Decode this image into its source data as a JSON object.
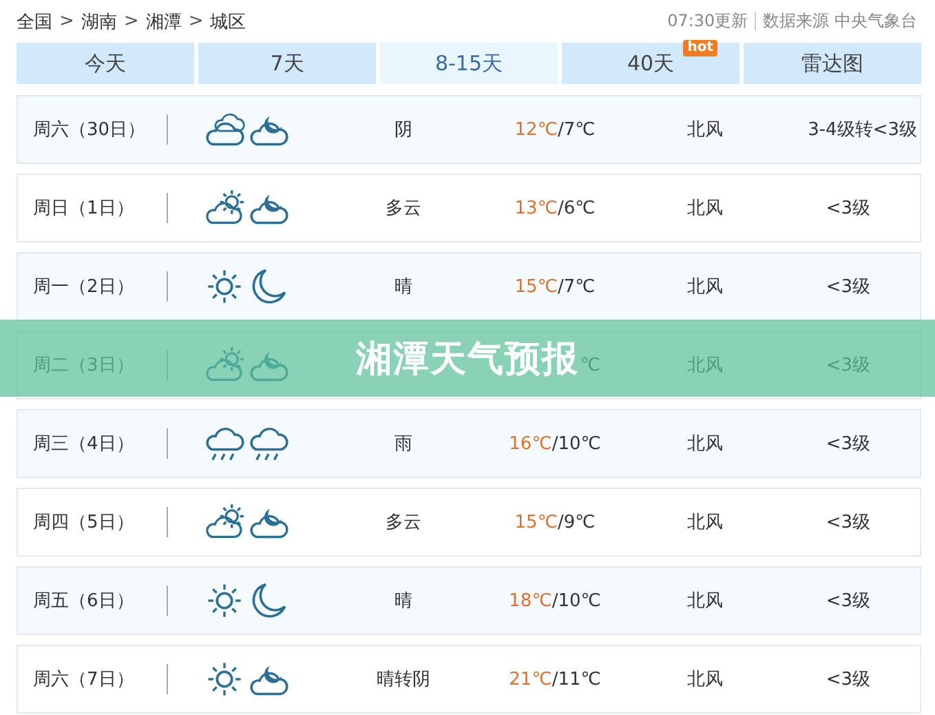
{
  "breadcrumb": [
    "全国",
    "湖南",
    "湘潭",
    "城区"
  ],
  "breadcrumb_separator": ">",
  "update_time": "07:30更新",
  "source": "数据来源 中央气象台",
  "tabs": [
    {
      "label": "今天",
      "selected": false
    },
    {
      "label": "7天",
      "selected": false
    },
    {
      "label": "8-15天",
      "selected": true
    },
    {
      "label": "40天",
      "selected": false,
      "badge": "hot"
    },
    {
      "label": "雷达图",
      "selected": false
    }
  ],
  "days": [
    {
      "day": "周六（30日）",
      "icons": [
        {
          "kind": "cloudy"
        },
        {
          "kind": "cloud-moon"
        }
      ],
      "weather": "阴",
      "high": "12℃",
      "low": "/7℃",
      "wind": "北风",
      "level": "3-4级转<3级"
    },
    {
      "day": "周日（1日）",
      "icons": [
        {
          "kind": "sun-cloud"
        },
        {
          "kind": "cloud-moon"
        }
      ],
      "weather": "多云",
      "high": "13℃",
      "low": "/6℃",
      "wind": "北风",
      "level": "<3级"
    },
    {
      "day": "周一（2日）",
      "icons": [
        {
          "kind": "sun"
        },
        {
          "kind": "moon"
        }
      ],
      "weather": "晴",
      "high": "15℃",
      "low": "/7℃",
      "wind": "北风",
      "level": "<3级"
    },
    {
      "day": "周二（3日）",
      "icons": [
        {
          "kind": "sun-cloud"
        },
        {
          "kind": "cloud-moon"
        }
      ],
      "low": "℃",
      "wind": "北风",
      "level": "<3级"
    },
    {
      "day": "周三（4日）",
      "icons": [
        {
          "kind": "rain"
        },
        {
          "kind": "rain"
        }
      ],
      "weather": "雨",
      "high": "16℃",
      "low": "/10℃",
      "wind": "北风",
      "level": "<3级"
    },
    {
      "day": "周四（5日）",
      "icons": [
        {
          "kind": "sun-cloud"
        },
        {
          "kind": "cloud-moon"
        }
      ],
      "weather": "多云",
      "high": "15℃",
      "low": "/9℃",
      "wind": "北风",
      "level": "<3级"
    },
    {
      "day": "周五（6日）",
      "icons": [
        {
          "kind": "sun"
        },
        {
          "kind": "moon"
        }
      ],
      "weather": "晴",
      "high": "18℃",
      "low": "/10℃",
      "wind": "北风",
      "level": "<3级"
    },
    {
      "day": "周六（7日）",
      "icons": [
        {
          "kind": "sun"
        },
        {
          "kind": "cloud-moon"
        }
      ],
      "weather": "晴转阴",
      "high": "21℃",
      "low": "/11℃",
      "wind": "北风",
      "level": "<3级"
    }
  ],
  "banner": {
    "title": "湘潭天气预报"
  }
}
